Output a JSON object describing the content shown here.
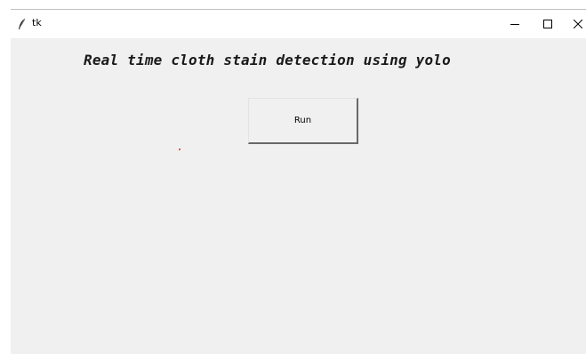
{
  "window": {
    "title": "tk",
    "controls": {
      "minimize_icon": "minimize-icon",
      "maximize_icon": "maximize-icon",
      "close_icon": "close-icon"
    }
  },
  "content": {
    "heading": "Real time cloth stain detection using yolo",
    "run_button_label": "Run"
  },
  "colors": {
    "window_background": "#f0f0f0",
    "titlebar_background": "#ffffff"
  }
}
